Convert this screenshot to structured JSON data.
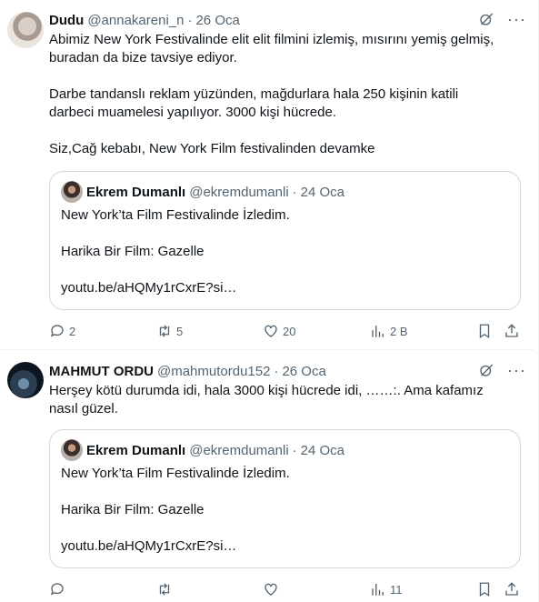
{
  "tweets": [
    {
      "name": "Dudu",
      "handle": "@annakareni_n",
      "date": "26 Oca",
      "text": "Abimiz New York Festivalinde elit elit filmini izlemiş, mısırını yemiş gelmiş,\nburadan da bize tavsiye ediyor.\n\nDarbe tandanslı reklam yüzünden, mağdurlara hala 250 kişinin katili\ndarbeci muamelesi yapılıyor. 3000 kişi hücrede.\n\nSiz,Cağ kebabı, New York Film festivalinden devamke",
      "quote": {
        "name": "Ekrem Dumanlı",
        "handle": "@ekremdumanli",
        "date": "24 Oca",
        "text": "New York’ta Film Festivalinde İzledim.\n\nHarika Bir Film: Gazelle\n\nyoutu.be/aHQMy1rCxrE?si…"
      },
      "stats": {
        "replies": "2",
        "retweets": "5",
        "likes": "20",
        "views": "2 B"
      }
    },
    {
      "name": "MAHMUT ORDU",
      "handle": "@mahmutordu152",
      "date": "26 Oca",
      "text": "Herşey kötü durumda idi, hala 3000 kişi hücrede idi, ……:. Ama kafamız\nnasıl güzel.",
      "quote": {
        "name": "Ekrem Dumanlı",
        "handle": "@ekremdumanli",
        "date": "24 Oca",
        "text": "New York’ta Film Festivalinde İzledim.\n\nHarika Bir Film: Gazelle\n\nyoutu.be/aHQMy1rCxrE?si…"
      },
      "stats": {
        "replies": "",
        "retweets": "",
        "likes": "",
        "views": "11"
      }
    }
  ],
  "separator": "·",
  "more_glyph": "···",
  "icons": [
    "grok-icon",
    "more-icon",
    "reply-icon",
    "retweet-icon",
    "like-icon",
    "views-icon",
    "bookmark-icon",
    "share-icon"
  ],
  "colors": {
    "text": "#0f1419",
    "secondary": "#536471",
    "border": "#cfd9de",
    "divider": "#eff3f4"
  }
}
